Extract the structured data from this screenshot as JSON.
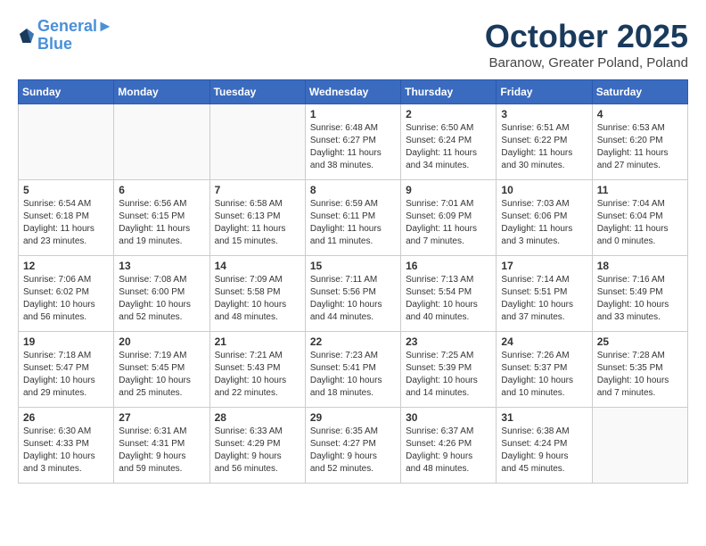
{
  "header": {
    "logo_line1": "General",
    "logo_line2": "Blue",
    "month": "October 2025",
    "location": "Baranow, Greater Poland, Poland"
  },
  "weekdays": [
    "Sunday",
    "Monday",
    "Tuesday",
    "Wednesday",
    "Thursday",
    "Friday",
    "Saturday"
  ],
  "weeks": [
    [
      {
        "day": "",
        "info": ""
      },
      {
        "day": "",
        "info": ""
      },
      {
        "day": "",
        "info": ""
      },
      {
        "day": "1",
        "info": "Sunrise: 6:48 AM\nSunset: 6:27 PM\nDaylight: 11 hours\nand 38 minutes."
      },
      {
        "day": "2",
        "info": "Sunrise: 6:50 AM\nSunset: 6:24 PM\nDaylight: 11 hours\nand 34 minutes."
      },
      {
        "day": "3",
        "info": "Sunrise: 6:51 AM\nSunset: 6:22 PM\nDaylight: 11 hours\nand 30 minutes."
      },
      {
        "day": "4",
        "info": "Sunrise: 6:53 AM\nSunset: 6:20 PM\nDaylight: 11 hours\nand 27 minutes."
      }
    ],
    [
      {
        "day": "5",
        "info": "Sunrise: 6:54 AM\nSunset: 6:18 PM\nDaylight: 11 hours\nand 23 minutes."
      },
      {
        "day": "6",
        "info": "Sunrise: 6:56 AM\nSunset: 6:15 PM\nDaylight: 11 hours\nand 19 minutes."
      },
      {
        "day": "7",
        "info": "Sunrise: 6:58 AM\nSunset: 6:13 PM\nDaylight: 11 hours\nand 15 minutes."
      },
      {
        "day": "8",
        "info": "Sunrise: 6:59 AM\nSunset: 6:11 PM\nDaylight: 11 hours\nand 11 minutes."
      },
      {
        "day": "9",
        "info": "Sunrise: 7:01 AM\nSunset: 6:09 PM\nDaylight: 11 hours\nand 7 minutes."
      },
      {
        "day": "10",
        "info": "Sunrise: 7:03 AM\nSunset: 6:06 PM\nDaylight: 11 hours\nand 3 minutes."
      },
      {
        "day": "11",
        "info": "Sunrise: 7:04 AM\nSunset: 6:04 PM\nDaylight: 11 hours\nand 0 minutes."
      }
    ],
    [
      {
        "day": "12",
        "info": "Sunrise: 7:06 AM\nSunset: 6:02 PM\nDaylight: 10 hours\nand 56 minutes."
      },
      {
        "day": "13",
        "info": "Sunrise: 7:08 AM\nSunset: 6:00 PM\nDaylight: 10 hours\nand 52 minutes."
      },
      {
        "day": "14",
        "info": "Sunrise: 7:09 AM\nSunset: 5:58 PM\nDaylight: 10 hours\nand 48 minutes."
      },
      {
        "day": "15",
        "info": "Sunrise: 7:11 AM\nSunset: 5:56 PM\nDaylight: 10 hours\nand 44 minutes."
      },
      {
        "day": "16",
        "info": "Sunrise: 7:13 AM\nSunset: 5:54 PM\nDaylight: 10 hours\nand 40 minutes."
      },
      {
        "day": "17",
        "info": "Sunrise: 7:14 AM\nSunset: 5:51 PM\nDaylight: 10 hours\nand 37 minutes."
      },
      {
        "day": "18",
        "info": "Sunrise: 7:16 AM\nSunset: 5:49 PM\nDaylight: 10 hours\nand 33 minutes."
      }
    ],
    [
      {
        "day": "19",
        "info": "Sunrise: 7:18 AM\nSunset: 5:47 PM\nDaylight: 10 hours\nand 29 minutes."
      },
      {
        "day": "20",
        "info": "Sunrise: 7:19 AM\nSunset: 5:45 PM\nDaylight: 10 hours\nand 25 minutes."
      },
      {
        "day": "21",
        "info": "Sunrise: 7:21 AM\nSunset: 5:43 PM\nDaylight: 10 hours\nand 22 minutes."
      },
      {
        "day": "22",
        "info": "Sunrise: 7:23 AM\nSunset: 5:41 PM\nDaylight: 10 hours\nand 18 minutes."
      },
      {
        "day": "23",
        "info": "Sunrise: 7:25 AM\nSunset: 5:39 PM\nDaylight: 10 hours\nand 14 minutes."
      },
      {
        "day": "24",
        "info": "Sunrise: 7:26 AM\nSunset: 5:37 PM\nDaylight: 10 hours\nand 10 minutes."
      },
      {
        "day": "25",
        "info": "Sunrise: 7:28 AM\nSunset: 5:35 PM\nDaylight: 10 hours\nand 7 minutes."
      }
    ],
    [
      {
        "day": "26",
        "info": "Sunrise: 6:30 AM\nSunset: 4:33 PM\nDaylight: 10 hours\nand 3 minutes."
      },
      {
        "day": "27",
        "info": "Sunrise: 6:31 AM\nSunset: 4:31 PM\nDaylight: 9 hours\nand 59 minutes."
      },
      {
        "day": "28",
        "info": "Sunrise: 6:33 AM\nSunset: 4:29 PM\nDaylight: 9 hours\nand 56 minutes."
      },
      {
        "day": "29",
        "info": "Sunrise: 6:35 AM\nSunset: 4:27 PM\nDaylight: 9 hours\nand 52 minutes."
      },
      {
        "day": "30",
        "info": "Sunrise: 6:37 AM\nSunset: 4:26 PM\nDaylight: 9 hours\nand 48 minutes."
      },
      {
        "day": "31",
        "info": "Sunrise: 6:38 AM\nSunset: 4:24 PM\nDaylight: 9 hours\nand 45 minutes."
      },
      {
        "day": "",
        "info": ""
      }
    ]
  ]
}
